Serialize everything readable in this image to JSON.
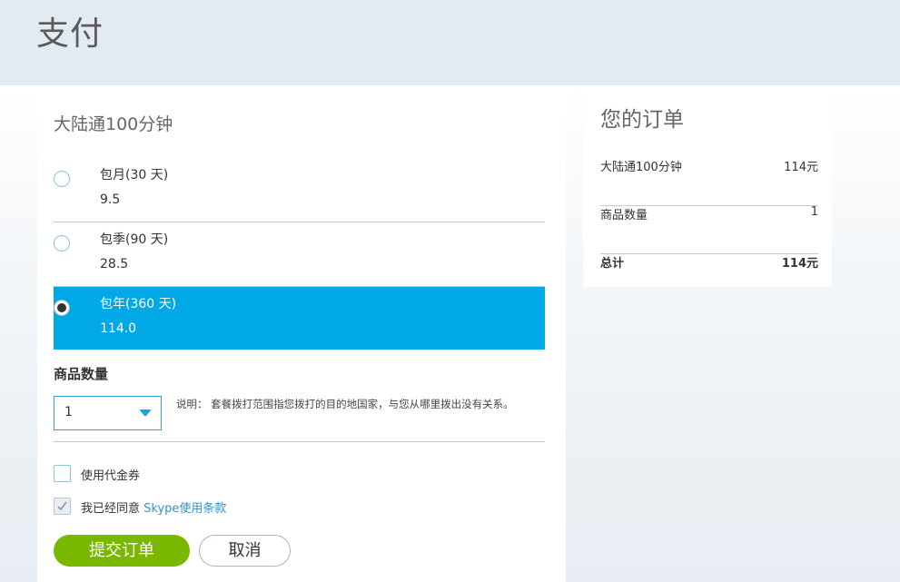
{
  "page": {
    "title": "支付"
  },
  "plan": {
    "title": "大陆通100分钟",
    "options": [
      {
        "name": "包月(30 天)",
        "price": "9.5",
        "selected": false
      },
      {
        "name": "包季(90 天)",
        "price": "28.5",
        "selected": false
      },
      {
        "name": "包年(360 天)",
        "price": "114.0",
        "selected": true
      }
    ]
  },
  "quantity": {
    "label": "商品数量",
    "value": "1",
    "note": "说明： 套餐拨打范围指您拨打的目的地国家，与您从哪里拨出没有关系。"
  },
  "checks": {
    "coupon": {
      "label": "使用代金券",
      "checked": false
    },
    "agree": {
      "label": "我已经同意",
      "link": "Skype使用条款",
      "checked": true
    }
  },
  "buttons": {
    "submit": "提交订单",
    "cancel": "取消"
  },
  "order": {
    "title": "您的订单",
    "rows": [
      {
        "key": "大陆通100分钟",
        "value": "114元"
      },
      {
        "key": "商品数量",
        "value": "1"
      },
      {
        "key": "总计",
        "value": "114元"
      }
    ]
  },
  "colors": {
    "selected": "#00a8e6",
    "submit": "#7ab800",
    "link": "#3a8fc9",
    "border": "#2fa5d6"
  },
  "icons": {
    "caret": "caret-down-icon",
    "check": "checkmark-icon"
  }
}
